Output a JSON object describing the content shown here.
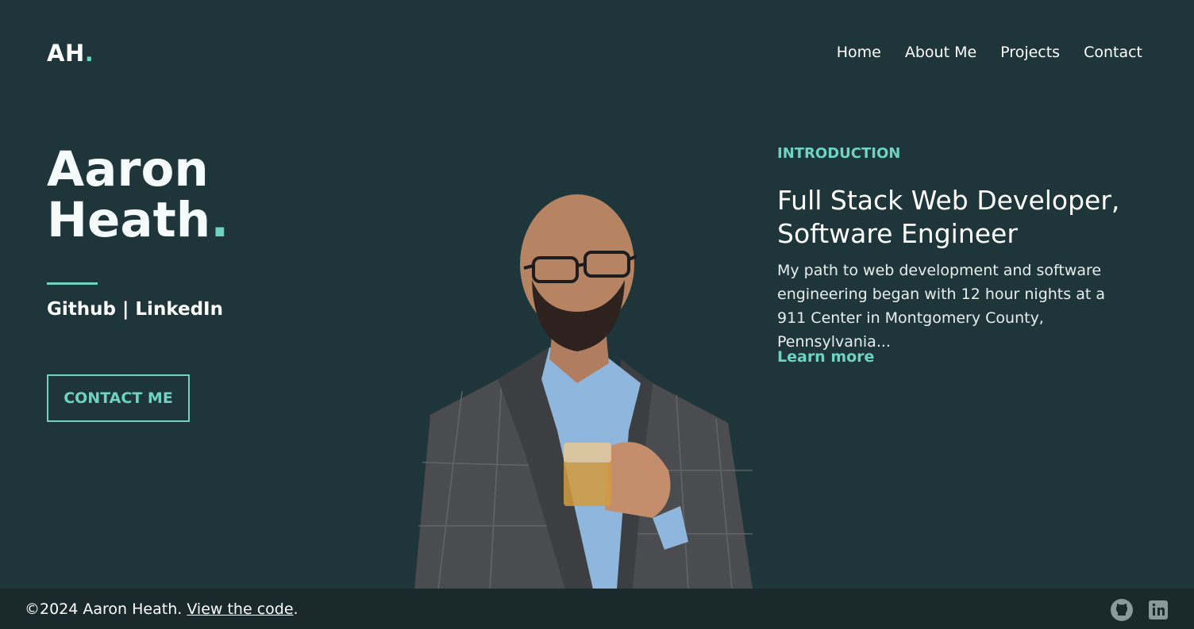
{
  "brand": {
    "logo_text": "AH",
    "logo_dot": "."
  },
  "nav": {
    "items": [
      {
        "label": "Home"
      },
      {
        "label": "About Me"
      },
      {
        "label": "Projects"
      },
      {
        "label": "Contact"
      }
    ]
  },
  "hero": {
    "first_name": "Aaron",
    "last_name": "Heath",
    "name_dot": ".",
    "github_label": "Github",
    "separator": "|",
    "linkedin_label": "LinkedIn",
    "contact_button": "CONTACT ME"
  },
  "intro": {
    "label": "INTRODUCTION",
    "headline_line1": "Full Stack Web Developer,",
    "headline_line2": "Software Engineer",
    "body": "My path to web development and software engineering began with 12 hour nights at a 911 Center in Montgomery County, Pennsylvania...",
    "learn_more": "Learn more"
  },
  "footer": {
    "copyright": "©2024 Aaron Heath.",
    "code_link": "View the code",
    "period": ".",
    "icons": [
      "github-icon",
      "linkedin-icon"
    ]
  },
  "colors": {
    "background": "#1e3539",
    "footer_background": "#19292c",
    "accent": "#6fd3c2",
    "text": "#ffffff"
  }
}
